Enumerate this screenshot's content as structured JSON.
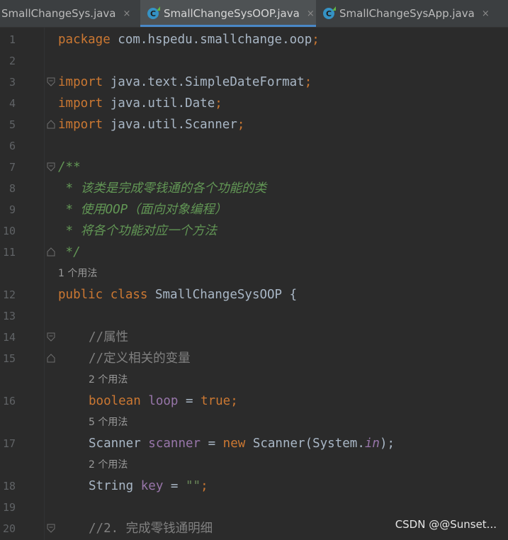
{
  "tabs": [
    {
      "label": "SmallChangeSys.java",
      "close": "×"
    },
    {
      "label": "SmallChangeSysOOP.java",
      "close": "×"
    },
    {
      "label": "SmallChangeSysApp.java",
      "close": "×"
    }
  ],
  "editor": {
    "l1": {
      "n": "1",
      "a": "package",
      "b": " com.hspedu.smallchange.oop",
      ";": ";"
    },
    "l2": {
      "n": "2"
    },
    "l3": {
      "n": "3",
      "a": "import",
      "b": " java.text.SimpleDateFormat",
      "c": ";"
    },
    "l4": {
      "n": "4",
      "a": "import",
      "b": " java.util.Date",
      "c": ";"
    },
    "l5": {
      "n": "5",
      "a": "import",
      "b": " java.util.Scanner",
      "c": ";"
    },
    "l6": {
      "n": "6"
    },
    "l7": {
      "n": "7",
      "t": "/**"
    },
    "l8": {
      "n": "8",
      "t": " * 该类是完成零钱通的各个功能的类"
    },
    "l9": {
      "n": "9",
      "t": " * 使用OOP（面向对象编程）"
    },
    "l10": {
      "n": "10",
      "t": " * 将各个功能对应一个方法"
    },
    "l11": {
      "n": "11",
      "t": " */"
    },
    "hint_class": "1 个用法",
    "l12": {
      "n": "12",
      "a": "public class",
      "b": " SmallChangeSysOOP {"
    },
    "l13": {
      "n": "13"
    },
    "l14": {
      "n": "14",
      "t": "//属性"
    },
    "l15": {
      "n": "15",
      "t": "//定义相关的变量"
    },
    "hint_loop": "2 个用法",
    "l16": {
      "n": "16",
      "a": "boolean",
      "b": " ",
      "c": "loop",
      "d": " = ",
      "e": "true",
      ";": ";"
    },
    "hint_scanner": "5 个用法",
    "l17": {
      "n": "17",
      "a": "Scanner ",
      "b": "scanner",
      "c": " = ",
      "d": "new",
      "e": " Scanner(System.",
      "f": "in",
      "g": ");"
    },
    "hint_key": "2 个用法",
    "l18": {
      "n": "18",
      "a": "String ",
      "b": "key",
      "c": " = ",
      "d": "\"\"",
      ";": ";"
    },
    "l19": {
      "n": "19"
    },
    "l20": {
      "n": "20",
      "t": "//2. 完成零钱通明细"
    }
  },
  "watermark": "CSDN @@Sunset..."
}
